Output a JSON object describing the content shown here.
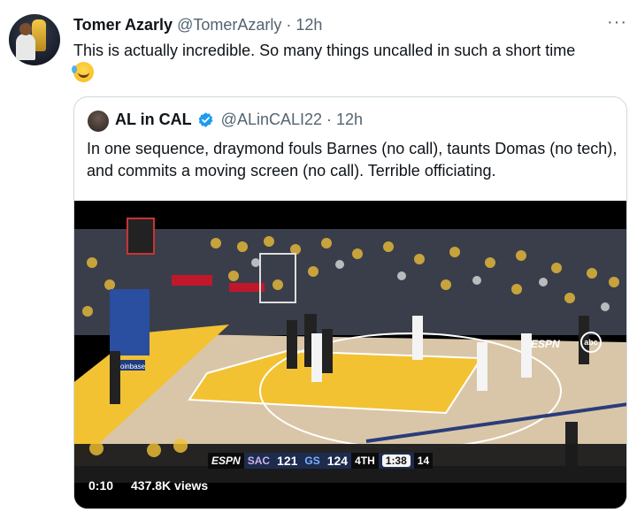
{
  "tweet": {
    "author_name": "Tomer Azarly",
    "author_handle": "@TomerAzarly",
    "separator": "·",
    "time": "12h",
    "text": "This is actually incredible. So many things uncalled in such a short time",
    "emoji": "rolling-on-floor-laughing",
    "more_label": "···"
  },
  "quoted_tweet": {
    "author_name": "AL in CAL",
    "author_handle": "@ALinCALI22",
    "separator": "·",
    "time": "12h",
    "text": "In one sequence, draymond fouls Barnes (no call), taunts Domas (no tech), and commits a moving screen (no call). Terrible officiating.",
    "verified_color": "#1d9bf0"
  },
  "video": {
    "elapsed": "0:10",
    "views": "437.8K views",
    "network_top": "ESPN",
    "network_badge": "abc",
    "scoreboard": {
      "network": "ESPN",
      "team1": "SAC",
      "score1": "121",
      "team2": "GS",
      "score2": "124",
      "quarter": "4TH",
      "clock": "1:38",
      "shot_clock": "14"
    }
  }
}
